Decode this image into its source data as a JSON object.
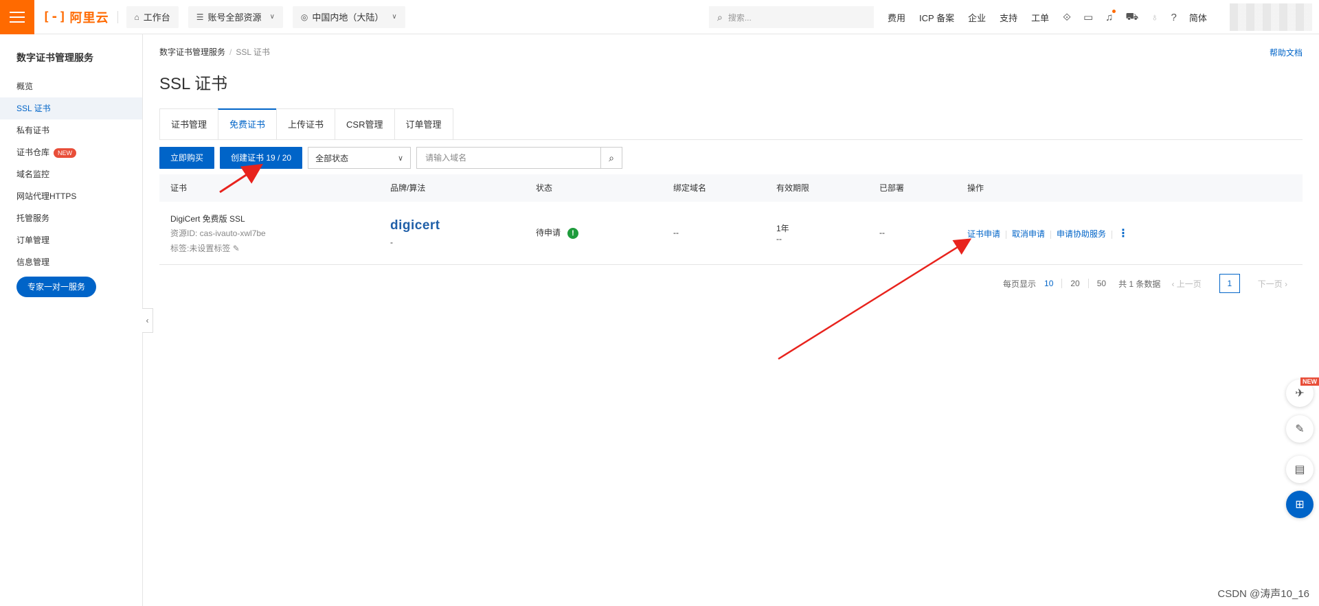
{
  "topbar": {
    "logo": "阿里云",
    "workbench": "工作台",
    "resources": "账号全部资源",
    "region": "中国内地（大陆）",
    "search_placeholder": "搜索...",
    "links": [
      "费用",
      "ICP 备案",
      "企业",
      "支持",
      "工单"
    ],
    "lang": "简体"
  },
  "sidebar": {
    "title": "数字证书管理服务",
    "items": [
      {
        "label": "概览"
      },
      {
        "label": "SSL 证书"
      },
      {
        "label": "私有证书"
      },
      {
        "label": "证书仓库",
        "badge": "NEW"
      },
      {
        "label": "域名监控"
      },
      {
        "label": "网站代理HTTPS"
      },
      {
        "label": "托管服务"
      },
      {
        "label": "订单管理"
      },
      {
        "label": "信息管理"
      }
    ],
    "expert_button": "专家一对一服务"
  },
  "breadcrumb": {
    "root": "数字证书管理服务",
    "current": "SSL 证书"
  },
  "help": "帮助文档",
  "page_title": "SSL 证书",
  "tabs": [
    "证书管理",
    "免费证书",
    "上传证书",
    "CSR管理",
    "订单管理"
  ],
  "toolbar": {
    "buy": "立即购买",
    "create": "创建证书 19 / 20",
    "status_select": "全部状态",
    "domain_placeholder": "请输入域名"
  },
  "table": {
    "headers": [
      "证书",
      "品牌/算法",
      "状态",
      "绑定域名",
      "有效期限",
      "已部署",
      "操作"
    ],
    "rows": [
      {
        "name": "DigiCert 免费版 SSL",
        "resource_id": "资源ID: cas-ivauto-xwl7be",
        "tag": "标签:未设置标签",
        "brand": "digicert",
        "algo": "-",
        "status": "待申请",
        "domain": "--",
        "validity": "1年",
        "validity_sub": "--",
        "deployed": "--",
        "actions": [
          "证书申请",
          "取消申请",
          "申请协助服务"
        ]
      }
    ]
  },
  "pager": {
    "per_page_label": "每页显示",
    "sizes": [
      "10",
      "20",
      "50"
    ],
    "total": "共 1 条数据",
    "prev": "上一页",
    "page": "1",
    "next": "下一页"
  },
  "float_new": "NEW",
  "watermark": "CSDN @涛声10_16",
  "colors": {
    "brand": "#ff6a00",
    "primary": "#0064c8",
    "arrow": "#e8231d"
  }
}
